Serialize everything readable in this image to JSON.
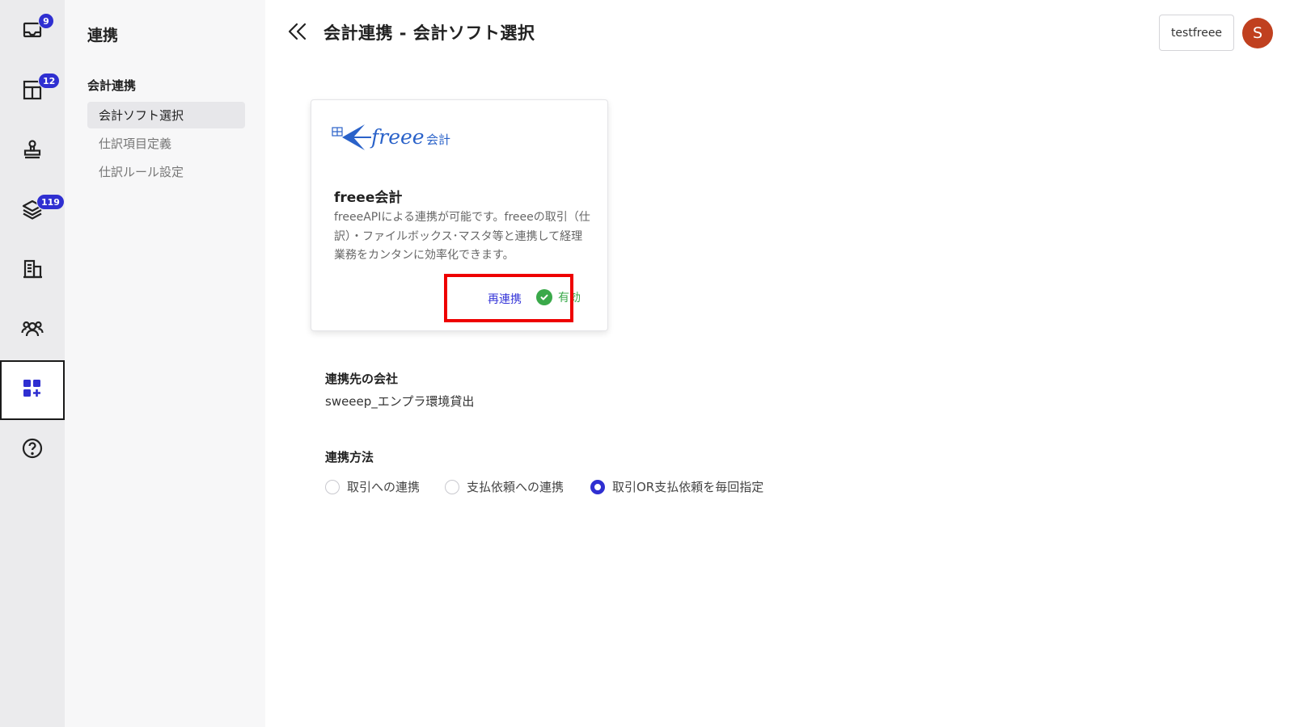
{
  "rail": {
    "items": [
      {
        "name": "inbox",
        "badge": "9"
      },
      {
        "name": "document-grid",
        "badge": "12"
      },
      {
        "name": "approval-stamp",
        "badge": ""
      },
      {
        "name": "layers",
        "badge": "119"
      },
      {
        "name": "company",
        "badge": ""
      },
      {
        "name": "team",
        "badge": ""
      },
      {
        "name": "integrations",
        "badge": ""
      },
      {
        "name": "help",
        "badge": ""
      }
    ],
    "active_color": "#2f2fd1"
  },
  "subnav": {
    "title": "連携",
    "group_label": "会計連携",
    "items": [
      {
        "label": "会計ソフト選択"
      },
      {
        "label": "仕訳項目定義"
      },
      {
        "label": "仕訳ルール設定"
      }
    ]
  },
  "header": {
    "title": "会計連携 - 会計ソフト選択",
    "workspace_label": "testfreee",
    "avatar_initial": "S",
    "avatar_color": "#c0401f"
  },
  "card": {
    "logo_text": "freee",
    "logo_suffix": "会計",
    "title": "freee会計",
    "description": "freeeAPIによる連携が可能です。freeeの取引（仕訳）・ファイルボックス･マスタ等と連携して経理業務をカンタンに効率化できます。",
    "relink_label": "再連携",
    "status_label": "有効",
    "status_color": "#3aa94a",
    "highlight_color": "#ee0000"
  },
  "linked_company": {
    "label": "連携先の会社",
    "value": "sweeep_エンプラ環境貸出"
  },
  "method": {
    "label": "連携方法",
    "options": [
      {
        "label": "取引への連携",
        "selected": false
      },
      {
        "label": "支払依頼への連携",
        "selected": false
      },
      {
        "label": "取引OR支払依頼を毎回指定",
        "selected": true
      }
    ]
  }
}
